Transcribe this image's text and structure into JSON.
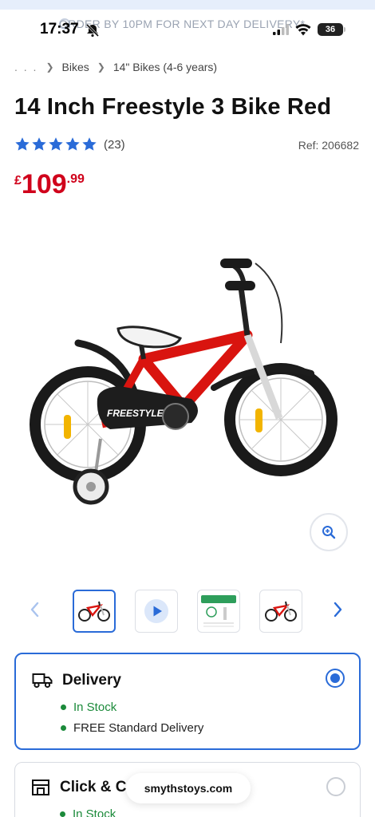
{
  "status_bar": {
    "time": "17:37",
    "battery": "36",
    "promo": "ORDER BY 10PM FOR NEXT DAY DELIVERY*"
  },
  "breadcrumb": {
    "ellipsis": ". . .",
    "items": [
      "Bikes",
      "14\" Bikes (4-6 years)"
    ]
  },
  "product": {
    "title": "14 Inch Freestyle 3 Bike Red",
    "rating_stars": 5,
    "review_count": "(23)",
    "ref": "Ref: 206682",
    "price_currency": "£",
    "price_main": "109",
    "price_pence": ".99",
    "image_icon": "bike-red-product-photo"
  },
  "gallery": {
    "prev_icon": "chevron-left-icon",
    "next_icon": "chevron-right-icon",
    "zoom_icon": "zoom-in-icon",
    "thumbnails": [
      {
        "icon": "bike-thumbnail",
        "active": true
      },
      {
        "icon": "play-video-icon",
        "active": false
      },
      {
        "icon": "size-guide-thumbnail",
        "active": false
      },
      {
        "icon": "bike-thumbnail",
        "active": false
      }
    ]
  },
  "delivery": {
    "title": "Delivery",
    "icon": "truck-icon",
    "selected": true,
    "stock": "In Stock",
    "shipping": "FREE Standard Delivery"
  },
  "collect": {
    "title": "Click & C",
    "icon": "store-icon",
    "selected": false,
    "stock": "In Stock"
  },
  "browser": {
    "url": "smythstoys.com"
  },
  "colors": {
    "accent": "#2a6bd8",
    "price": "#d0021b",
    "stock": "#1b8a3a"
  }
}
